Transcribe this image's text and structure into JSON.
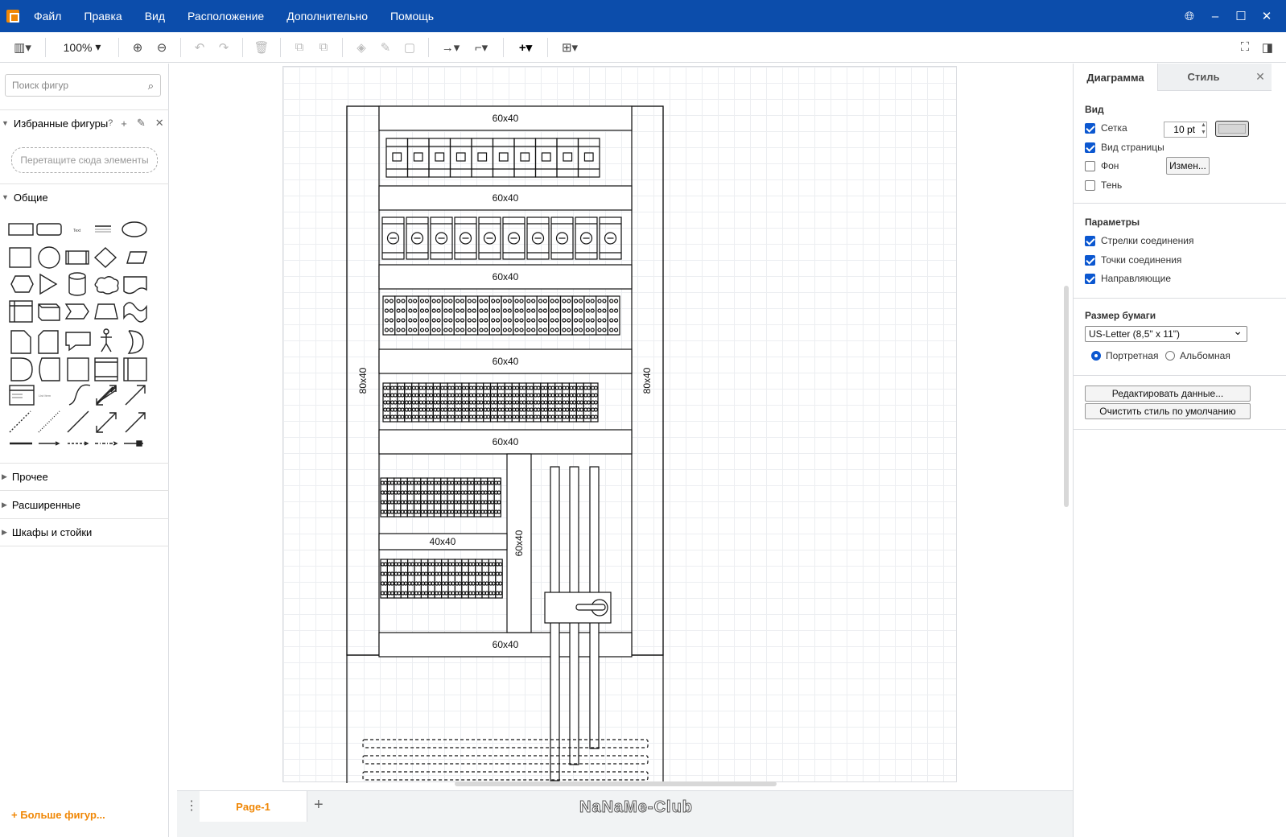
{
  "menu": [
    "Файл",
    "Правка",
    "Вид",
    "Расположение",
    "Дополнительно",
    "Помощь"
  ],
  "toolbar": {
    "zoom": "100%"
  },
  "left": {
    "search_placeholder": "Поиск фигур",
    "favorites_title": "Избранные фигуры",
    "drop_hint": "Перетащите сюда элементы",
    "general_title": "Общие",
    "other_title": "Прочее",
    "advanced_title": "Расширенные",
    "racks_title": "Шкафы и стойки",
    "more_shapes": "Больше фигур..."
  },
  "bottom": {
    "page_tab": "Page-1",
    "watermark": "NaNaMe-Club"
  },
  "right": {
    "tab_diagram": "Диаграмма",
    "tab_style": "Стиль",
    "view_title": "Вид",
    "grid_label": "Сетка",
    "grid_size": "10 pt",
    "page_view_label": "Вид страницы",
    "background_label": "Фон",
    "change_btn": "Измен...",
    "shadow_label": "Тень",
    "params_title": "Параметры",
    "conn_arrows_label": "Стрелки соединения",
    "conn_points_label": "Точки соединения",
    "guides_label": "Направляющие",
    "paper_title": "Размер бумаги",
    "paper_value": "US-Letter (8,5\" x 11\")",
    "portrait_label": "Портретная",
    "landscape_label": "Альбомная",
    "edit_data_btn": "Редактировать данные...",
    "clear_style_btn": "Очистить стиль по умолчанию"
  },
  "diagram": {
    "label_6040": "60x40",
    "label_8040": "80x40",
    "label_4040": "40x40"
  }
}
